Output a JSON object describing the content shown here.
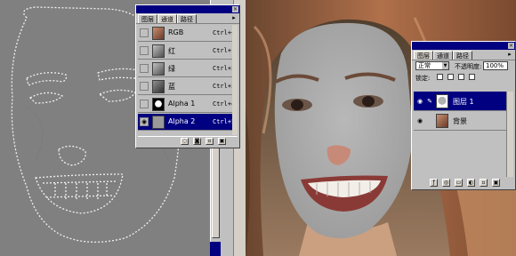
{
  "channels_panel": {
    "tabs": [
      "图层",
      "通道",
      "路径"
    ],
    "active_tab": 1,
    "menu_icon": "triangle-right-icon",
    "rows": [
      {
        "name": "RGB",
        "shortcut": "Ctrl+~",
        "visible": false,
        "selected": false,
        "thumb": "color"
      },
      {
        "name": "红",
        "shortcut": "Ctrl+1",
        "visible": false,
        "selected": false,
        "thumb": "gray"
      },
      {
        "name": "绿",
        "shortcut": "Ctrl+2",
        "visible": false,
        "selected": false,
        "thumb": "gray"
      },
      {
        "name": "蓝",
        "shortcut": "Ctrl+3",
        "visible": false,
        "selected": false,
        "thumb": "dark"
      },
      {
        "name": "Alpha 1",
        "shortcut": "Ctrl+4",
        "visible": false,
        "selected": false,
        "thumb": "mask"
      },
      {
        "name": "Alpha 2",
        "shortcut": "Ctrl+5",
        "visible": true,
        "selected": true,
        "thumb": "plain"
      }
    ],
    "bottom_icons": [
      "load-selection-icon",
      "save-selection-icon",
      "new-channel-icon",
      "delete-channel-icon"
    ]
  },
  "layers_panel": {
    "tabs": [
      "图层",
      "通道",
      "路径"
    ],
    "active_tab": 0,
    "blend_mode": "正常",
    "opacity_label": "不透明度:",
    "opacity_value": "100%",
    "lock_label": "锁定:",
    "rows": [
      {
        "name": "图层 1",
        "visible": true,
        "linked": true,
        "selected": true
      },
      {
        "name": "背景",
        "visible": true,
        "linked": false,
        "selected": false
      }
    ],
    "bottom_icons": [
      "layer-style-icon",
      "add-mask-icon",
      "new-set-icon",
      "adjustment-layer-icon",
      "new-layer-icon",
      "delete-layer-icon"
    ]
  },
  "colors": {
    "selection_blue": "#000080",
    "panel_gray": "#c0c0c0",
    "canvas_gray": "#808080"
  }
}
